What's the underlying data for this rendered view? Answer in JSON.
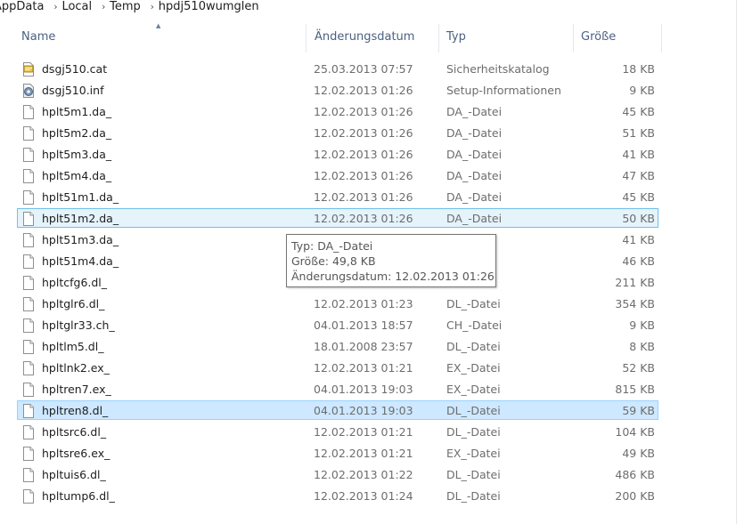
{
  "breadcrumb": [
    "AppData",
    "Local",
    "Temp",
    "hpdj510wumglen"
  ],
  "columns": {
    "name": "Name",
    "date": "Änderungsdatum",
    "type": "Typ",
    "size": "Größe"
  },
  "files": [
    {
      "name": "dsgj510.cat",
      "date": "25.03.2013 07:57",
      "type": "Sicherheitskatalog",
      "size": "18 KB",
      "icon": "catalog-icon"
    },
    {
      "name": "dsgj510.inf",
      "date": "12.02.2013 01:26",
      "type": "Setup-Informationen",
      "size": "9 KB",
      "icon": "setup-info-icon"
    },
    {
      "name": "hplt5m1.da_",
      "date": "12.02.2013 01:26",
      "type": "DA_-Datei",
      "size": "45 KB",
      "icon": "file-icon"
    },
    {
      "name": "hplt5m2.da_",
      "date": "12.02.2013 01:26",
      "type": "DA_-Datei",
      "size": "51 KB",
      "icon": "file-icon"
    },
    {
      "name": "hplt5m3.da_",
      "date": "12.02.2013 01:26",
      "type": "DA_-Datei",
      "size": "41 KB",
      "icon": "file-icon"
    },
    {
      "name": "hplt5m4.da_",
      "date": "12.02.2013 01:26",
      "type": "DA_-Datei",
      "size": "47 KB",
      "icon": "file-icon"
    },
    {
      "name": "hplt51m1.da_",
      "date": "12.02.2013 01:26",
      "type": "DA_-Datei",
      "size": "45 KB",
      "icon": "file-icon"
    },
    {
      "name": "hplt51m2.da_",
      "date": "12.02.2013 01:26",
      "type": "DA_-Datei",
      "size": "50 KB",
      "icon": "file-icon",
      "state": "hover"
    },
    {
      "name": "hplt51m3.da_",
      "date": "",
      "type": "",
      "size": "41 KB",
      "icon": "file-icon"
    },
    {
      "name": "hplt51m4.da_",
      "date": "",
      "type": "",
      "size": "46 KB",
      "icon": "file-icon"
    },
    {
      "name": "hpltcfg6.dl_",
      "date": "",
      "type": "",
      "size": "211 KB",
      "icon": "file-icon"
    },
    {
      "name": "hpltglr6.dl_",
      "date": "12.02.2013 01:23",
      "type": "DL_-Datei",
      "size": "354 KB",
      "icon": "file-icon"
    },
    {
      "name": "hpltglr33.ch_",
      "date": "04.01.2013 18:57",
      "type": "CH_-Datei",
      "size": "9 KB",
      "icon": "file-icon"
    },
    {
      "name": "hpltlm5.dl_",
      "date": "18.01.2008 23:57",
      "type": "DL_-Datei",
      "size": "8 KB",
      "icon": "file-icon"
    },
    {
      "name": "hpltlnk2.ex_",
      "date": "12.02.2013 01:21",
      "type": "EX_-Datei",
      "size": "52 KB",
      "icon": "file-icon"
    },
    {
      "name": "hpltren7.ex_",
      "date": "04.01.2013 19:03",
      "type": "EX_-Datei",
      "size": "815 KB",
      "icon": "file-icon"
    },
    {
      "name": "hpltren8.dl_",
      "date": "04.01.2013 19:03",
      "type": "DL_-Datei",
      "size": "59 KB",
      "icon": "file-icon",
      "state": "selected"
    },
    {
      "name": "hpltsrc6.dl_",
      "date": "12.02.2013 01:21",
      "type": "DL_-Datei",
      "size": "104 KB",
      "icon": "file-icon"
    },
    {
      "name": "hpltsre6.ex_",
      "date": "12.02.2013 01:21",
      "type": "EX_-Datei",
      "size": "49 KB",
      "icon": "file-icon"
    },
    {
      "name": "hpltuis6.dl_",
      "date": "12.02.2013 01:22",
      "type": "DL_-Datei",
      "size": "486 KB",
      "icon": "file-icon"
    },
    {
      "name": "hpltump6.dl_",
      "date": "12.02.2013 01:24",
      "type": "DL_-Datei",
      "size": "200 KB",
      "icon": "file-icon"
    }
  ],
  "tooltip": {
    "type_line": "Typ: DA_-Datei",
    "size_line": "Größe: 49,8 KB",
    "date_line": "Änderungsdatum: 12.02.2013 01:26"
  }
}
